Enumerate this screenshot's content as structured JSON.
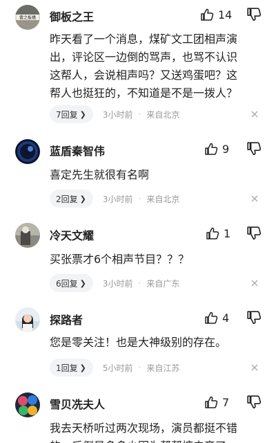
{
  "comments": [
    {
      "username": "御板之王",
      "likes": "14",
      "text": "昨天看了一个消息，煤矿文工团相声演\n出，评论区一边倒的骂声，也骂不认识\n这帮人，会说相声吗？又送鸡蛋吧？这\n帮人也挺狂的，不知道是不是一拨人？",
      "replies": "7回复",
      "time": "3小时前",
      "location": "来自北京",
      "avatar_text": "雲之板橋"
    },
    {
      "username": "蓝盾秦智伟",
      "likes": "9",
      "text": "喜定先生就很有名啊",
      "replies": "2回复",
      "time": "3小时前",
      "location": "来自北京"
    },
    {
      "username": "冷天文耀",
      "likes": "1",
      "text": "买张票才6个相声节目？？？",
      "replies": "6回复",
      "time": "3小时前",
      "location": "来自广东"
    },
    {
      "username": "探路者",
      "likes": "4",
      "text": "您是零关注！也是大神级别的存在。",
      "replies": "1回复",
      "time": "5小时前",
      "location": "来自江苏"
    },
    {
      "username": "雪贝冼夫人",
      "likes": "7",
      "text": "我去天桥听过两次现场，演员都挺不错\n的，后倒是多多少因为帮帮搪去帝了",
      "replies": "",
      "time": "",
      "location": ""
    }
  ],
  "icons": {
    "like": "thumbs-up-icon",
    "dislike": "thumbs-down-icon",
    "close": "close-icon",
    "chevron": "chevron-right-icon"
  },
  "colors": {
    "text_primary": "#222222",
    "text_meta": "#999999",
    "reply_bg": "#f2f3f5"
  }
}
